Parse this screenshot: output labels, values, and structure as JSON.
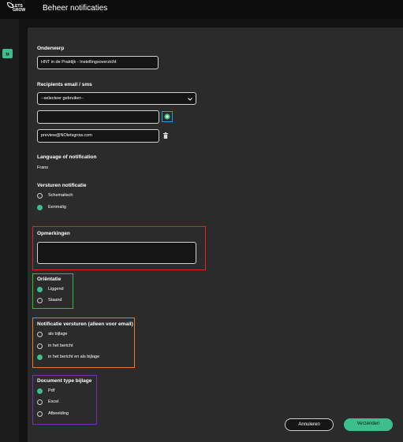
{
  "header": {
    "title": "Beheer notificaties",
    "logo_text": "LETS GROW"
  },
  "colors": {
    "accent": "#3cbf8c",
    "highlight_red": "#e02424",
    "highlight_green": "#2ec02e",
    "highlight_orange": "#f07820",
    "highlight_purple": "#7a2fa8",
    "highlight_blue": "#1a9fd6"
  },
  "icons": {
    "expand": "chevrons-right-icon",
    "add": "plus-circle-icon",
    "delete": "trash-icon"
  },
  "form": {
    "subject": {
      "label": "Onderwerp",
      "value": "HNT in de Praktijk - Instellingsoverzicht"
    },
    "recipients": {
      "label": "Recipients email / sms",
      "select_value": "--selecteer gebruiker--",
      "new_value": "",
      "email": "preview@NOletsgrow.com"
    },
    "language": {
      "label": "Language of notification",
      "value": "Frans"
    },
    "sending": {
      "label": "Versturen notificatie",
      "options": [
        "Schematisch",
        "Eenmalig"
      ],
      "selected": "Eenmalig"
    },
    "remarks": {
      "label": "Opmerkingen",
      "value": ""
    },
    "orientation": {
      "label": "Oriëntatie",
      "options": [
        "Liggend",
        "Staand"
      ],
      "selected": "Liggend"
    },
    "notify_email": {
      "label": "Notificatie versturen (alleen voor email)",
      "options": [
        "als bijlage",
        "in het bericht",
        "in het bericht en als bijlage"
      ],
      "selected": "in het bericht en als bijlage"
    },
    "doc_type": {
      "label": "Document type bijlage",
      "options": [
        "Pdf",
        "Excel",
        "Afbeelding"
      ],
      "selected": "Pdf"
    }
  },
  "buttons": {
    "cancel": "Annuleren",
    "send": "Verzenden"
  }
}
